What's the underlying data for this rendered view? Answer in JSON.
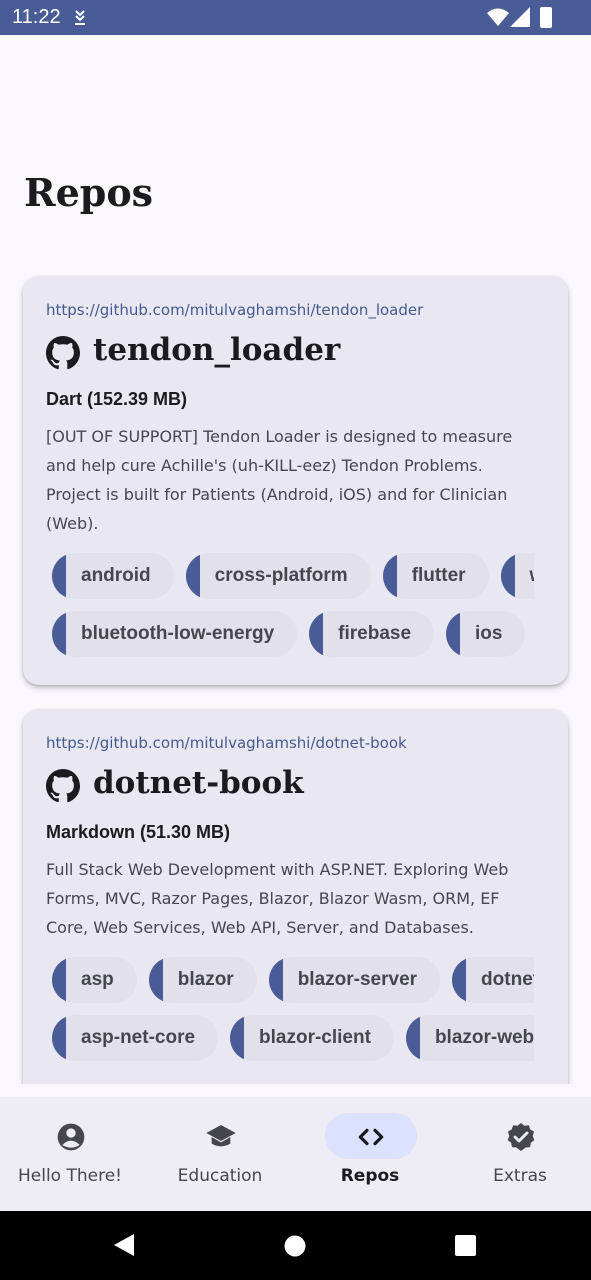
{
  "status_bar": {
    "time": "11:22"
  },
  "page": {
    "title": "Repos"
  },
  "repos": [
    {
      "url": "https://github.com/mitulvaghamshi/tendon_loader",
      "name": "tendon_loader",
      "language": "Dart (152.39 MB)",
      "description": "[OUT OF SUPPORT] Tendon Loader is designed to measure and help cure Achille's (uh-KILL-eez) Tendon Problems. Project is built for Patients (Android, iOS) and for Clinician (Web).",
      "topics_row1": [
        "android",
        "cross-platform",
        "flutter",
        "we"
      ],
      "topics_row2": [
        "bluetooth-low-energy",
        "firebase",
        "ios"
      ]
    },
    {
      "url": "https://github.com/mitulvaghamshi/dotnet-book",
      "name": "dotnet-book",
      "language": "Markdown (51.30 MB)",
      "description": "Full Stack Web Development with ASP.NET. Exploring Web Forms, MVC, Razor Pages, Blazor, Blazor Wasm, ORM, EF Core, Web Services, Web API, Server, and Databases.",
      "topics_row1": [
        "asp",
        "blazor",
        "blazor-server",
        "dotnet-fr"
      ],
      "topics_row2": [
        "asp-net-core",
        "blazor-client",
        "blazor-weba"
      ]
    }
  ],
  "bottom_nav": [
    {
      "label": "Hello There!",
      "icon": "person-circle-icon",
      "active": false
    },
    {
      "label": "Education",
      "icon": "school-cap-icon",
      "active": false
    },
    {
      "label": "Repos",
      "icon": "code-brackets-icon",
      "active": true
    },
    {
      "label": "Extras",
      "icon": "verified-badge-icon",
      "active": false
    }
  ],
  "colors": {
    "status_bar": "#4a5c95",
    "accent": "#4a5c95",
    "card": "#e9e8f2",
    "chip": "#e2e1eb",
    "nav_active_pill": "#dbe1ff"
  }
}
